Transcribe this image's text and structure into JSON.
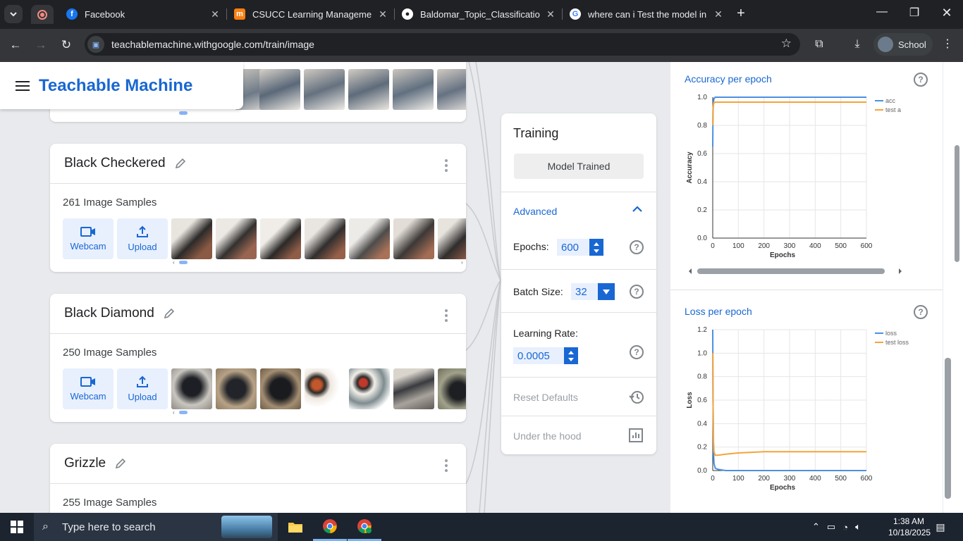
{
  "browser": {
    "tabs": [
      {
        "title": "Facebook",
        "icon": "facebook-icon",
        "color": "#1877f2"
      },
      {
        "title": "CSUCC Learning Management S",
        "icon": "moodle-icon",
        "color": "#f98012"
      },
      {
        "title": "Baldomar_Topic_Classification_F",
        "icon": "github-icon",
        "color": "#ffffff"
      },
      {
        "title": "where can i Test the model in th",
        "icon": "google-icon",
        "color": "#4285f4"
      }
    ],
    "url": "teachablemachine.withgoogle.com/train/image",
    "profile": "School"
  },
  "app": {
    "brand": "Teachable Machine",
    "accent": "#1967d2"
  },
  "classes": [
    {
      "name": "Black Checkered",
      "samples": "261 Image Samples",
      "webcam": "Webcam",
      "upload": "Upload"
    },
    {
      "name": "Black Diamond",
      "samples": "250 Image Samples",
      "webcam": "Webcam",
      "upload": "Upload"
    },
    {
      "name": "Grizzle",
      "samples": "255 Image Samples"
    }
  ],
  "training": {
    "title": "Training",
    "status_button": "Model Trained",
    "advanced": "Advanced",
    "epochs_label": "Epochs:",
    "epochs": "600",
    "batch_label": "Batch Size:",
    "batch": "32",
    "lr_label": "Learning Rate:",
    "lr": "0.0005",
    "reset": "Reset Defaults",
    "hood": "Under the hood"
  },
  "charts_panel": {
    "accuracy_title": "Accuracy per epoch",
    "loss_title": "Loss per epoch"
  },
  "chart_data": [
    {
      "type": "line",
      "title": "Accuracy per epoch",
      "xlabel": "Epochs",
      "ylabel": "Accuracy",
      "xlim": [
        0,
        600
      ],
      "ylim": [
        0,
        1.0
      ],
      "xticks": [
        "0",
        "100",
        "200",
        "300",
        "400",
        "500",
        "600"
      ],
      "yticks": [
        "0.0",
        "0.2",
        "0.4",
        "0.6",
        "0.8",
        "1.0"
      ],
      "legend": [
        "acc",
        "test a"
      ],
      "series": [
        {
          "name": "acc",
          "color": "#4a90e2",
          "x": [
            0,
            1,
            3,
            5,
            10,
            20,
            50,
            100,
            200,
            300,
            400,
            500,
            600
          ],
          "y": [
            0.65,
            0.9,
            0.97,
            0.99,
            1.0,
            1.0,
            1.0,
            1.0,
            1.0,
            1.0,
            1.0,
            1.0,
            1.0
          ]
        },
        {
          "name": "test a",
          "color": "#f5a33b",
          "x": [
            0,
            1,
            3,
            5,
            10,
            20,
            50,
            100,
            200,
            300,
            400,
            500,
            600
          ],
          "y": [
            0.8,
            0.92,
            0.95,
            0.96,
            0.965,
            0.965,
            0.965,
            0.965,
            0.965,
            0.965,
            0.965,
            0.965,
            0.965
          ]
        }
      ]
    },
    {
      "type": "line",
      "title": "Loss per epoch",
      "xlabel": "Epochs",
      "ylabel": "Loss",
      "xlim": [
        0,
        600
      ],
      "ylim": [
        0,
        1.2
      ],
      "xticks": [
        "0",
        "100",
        "200",
        "300",
        "400",
        "500",
        "600"
      ],
      "yticks": [
        "0.0",
        "0.2",
        "0.4",
        "0.6",
        "0.8",
        "1.0",
        "1.2"
      ],
      "legend": [
        "loss",
        "test loss"
      ],
      "series": [
        {
          "name": "loss",
          "color": "#4a90e2",
          "x": [
            0,
            1,
            3,
            5,
            10,
            20,
            50,
            100,
            200,
            300,
            400,
            500,
            600
          ],
          "y": [
            1.2,
            0.6,
            0.15,
            0.06,
            0.02,
            0.01,
            0.0,
            0.0,
            0.0,
            0.0,
            0.0,
            0.0,
            0.0
          ]
        },
        {
          "name": "test loss",
          "color": "#f5a33b",
          "x": [
            0,
            1,
            3,
            5,
            10,
            20,
            50,
            100,
            200,
            300,
            400,
            500,
            600
          ],
          "y": [
            1.0,
            0.6,
            0.25,
            0.16,
            0.13,
            0.13,
            0.14,
            0.15,
            0.16,
            0.16,
            0.16,
            0.16,
            0.16
          ]
        }
      ]
    }
  ],
  "taskbar": {
    "search_placeholder": "Type here to search",
    "time": "1:38 AM",
    "date": "10/18/2025"
  }
}
